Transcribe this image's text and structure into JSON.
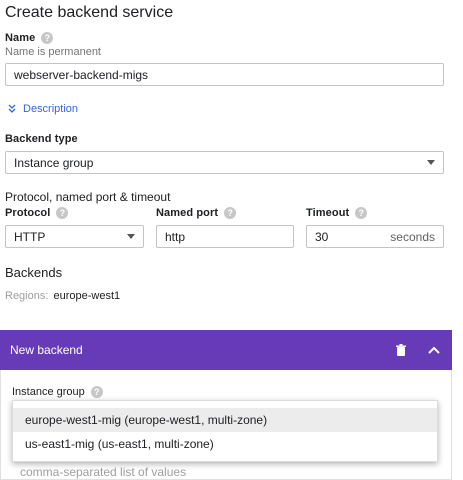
{
  "page": {
    "title": "Create backend service"
  },
  "name_field": {
    "label": "Name",
    "help": "?",
    "hint": "Name is permanent",
    "value": "webserver-backend-migs"
  },
  "description_toggle": {
    "label": "Description"
  },
  "backend_type": {
    "label": "Backend type",
    "value": "Instance group"
  },
  "protocol_section": {
    "heading": "Protocol, named port & timeout",
    "protocol": {
      "label": "Protocol",
      "value": "HTTP"
    },
    "named_port": {
      "label": "Named port",
      "value": "http"
    },
    "timeout": {
      "label": "Timeout",
      "value": "30",
      "unit": "seconds"
    }
  },
  "backends": {
    "heading": "Backends",
    "regions_label": "Regions:",
    "regions_value": "europe-west1"
  },
  "new_backend": {
    "title": "New backend",
    "band_color": "#673ab7"
  },
  "instance_group": {
    "label": "Instance group",
    "options": [
      {
        "label": "europe-west1-mig (europe-west1, multi-zone)",
        "highlighted": true
      },
      {
        "label": "us-east1-mig (us-east1, multi-zone)",
        "highlighted": false
      }
    ]
  },
  "partial_hint": {
    "text": "comma-separated list of values"
  },
  "icons": {
    "help": "help-circle-icon",
    "delete": "trash-icon",
    "collapse": "chevron-up-icon",
    "expand": "double-chevron-down-icon",
    "dropdown": "caret-down-icon"
  }
}
